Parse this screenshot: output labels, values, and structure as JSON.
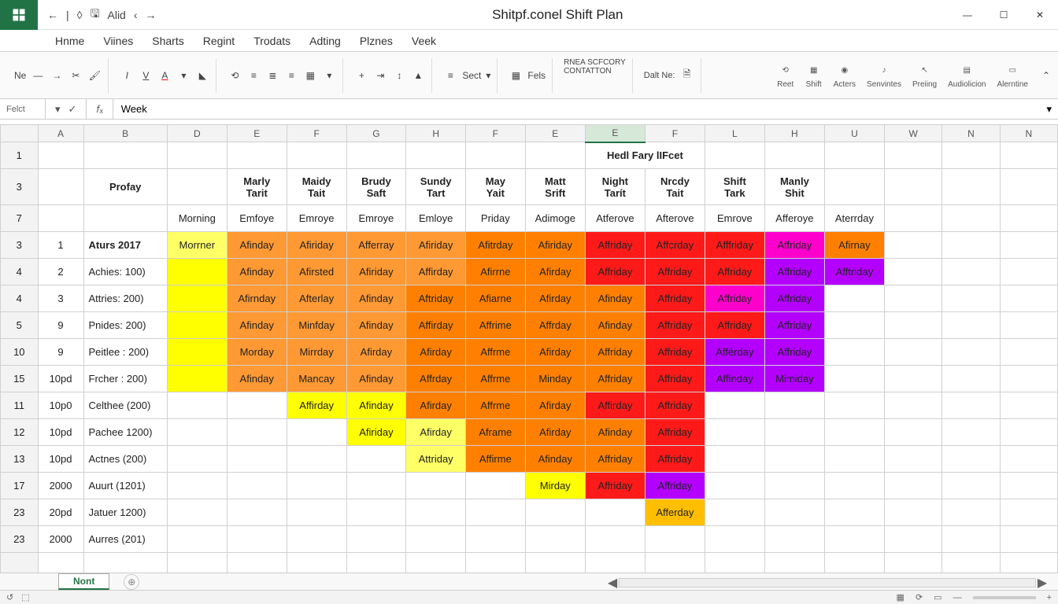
{
  "titlebar": {
    "qat_text": "Alid",
    "title": "Shitpf.conel Shift Plan"
  },
  "tabs": [
    "Hnme",
    "Viines",
    "Sharts",
    "Regint",
    "Trodats",
    "Adting",
    "Plznes",
    "Veek"
  ],
  "ribbon": {
    "left_label": "Ne",
    "sect": "Sect",
    "fels": "Fels",
    "box1a": "RNEA SCFCORY",
    "box1b": "CONTATTON",
    "box2": "Dalt Ne:",
    "icons": [
      "Reet",
      "Shift",
      "Acters",
      "Senvintes",
      "Preiing",
      "Audiolicion",
      "Alerntine"
    ]
  },
  "formula": {
    "namebox": "Felct",
    "value": "Week"
  },
  "columns": [
    "",
    "A",
    "B",
    "D",
    "E",
    "F",
    "G",
    "H",
    "F",
    "E",
    "E",
    "F",
    "L",
    "H",
    "U",
    "W",
    "N",
    "N"
  ],
  "selected_col": 10,
  "row_numbers": [
    "1",
    "3",
    "7",
    "3",
    "4",
    "4",
    "5",
    "10",
    "15",
    "11",
    "12",
    "13",
    "17",
    "23",
    "23"
  ],
  "title_row": "Hedl Fary lIFcet",
  "header_row2": [
    "Profay",
    "",
    "Marly Tarit",
    "Maidy Tait",
    "Brudy Saft",
    "Sundy Tart",
    "May Yait",
    "Matt Srift",
    "Night Tarít",
    "Nrcdy Tait",
    "Shift Tark",
    "Manly Shit",
    "",
    "",
    ""
  ],
  "header_row3": [
    "",
    "Morning",
    "Emfoye",
    "Emroye",
    "Emroye",
    "Emloye",
    "Priday",
    "Adimoge",
    "Atferove",
    "Afterove",
    "Emrove",
    "Afferoye",
    "Aterrday"
  ],
  "rows": [
    {
      "a": "1",
      "b": "Aturs 2017",
      "d": "Morrner",
      "cells": [
        {
          "t": "Afinday",
          "c": "c-ora"
        },
        {
          "t": "Afiriday",
          "c": "c-ora"
        },
        {
          "t": "Afferray",
          "c": "c-ora"
        },
        {
          "t": "Afiriday",
          "c": "c-ora"
        },
        {
          "t": "Afitrday",
          "c": "c-ora2"
        },
        {
          "t": "Afiriday",
          "c": "c-ora2"
        },
        {
          "t": "Affriday",
          "c": "c-red"
        },
        {
          "t": "Affcrday",
          "c": "c-red"
        },
        {
          "t": "Afffriday",
          "c": "c-red"
        },
        {
          "t": "Affriday",
          "c": "c-mag"
        },
        {
          "t": "Afirnay",
          "c": "c-ora2"
        }
      ]
    },
    {
      "a": "2",
      "b": "Achies: 100)",
      "d": "",
      "cells": [
        {
          "t": "Afinday",
          "c": "c-ora"
        },
        {
          "t": "Afirsted",
          "c": "c-ora"
        },
        {
          "t": "Afiriday",
          "c": "c-ora"
        },
        {
          "t": "Affirday",
          "c": "c-ora"
        },
        {
          "t": "Afirrne",
          "c": "c-ora2"
        },
        {
          "t": "Afirday",
          "c": "c-ora2"
        },
        {
          "t": "Affriday",
          "c": "c-red"
        },
        {
          "t": "Affriday",
          "c": "c-red"
        },
        {
          "t": "Affriday",
          "c": "c-red"
        },
        {
          "t": "Affriday",
          "c": "c-pur"
        },
        {
          "t": "Afftriday",
          "c": "c-pur"
        }
      ]
    },
    {
      "a": "3",
      "b": "Attries: 200)",
      "d": "",
      "cells": [
        {
          "t": "Afirnday",
          "c": "c-ora"
        },
        {
          "t": "Afterlay",
          "c": "c-ora"
        },
        {
          "t": "Afinday",
          "c": "c-ora"
        },
        {
          "t": "Aftriday",
          "c": "c-ora2"
        },
        {
          "t": "Afiarne",
          "c": "c-ora2"
        },
        {
          "t": "Afirday",
          "c": "c-ora2"
        },
        {
          "t": "Afinday",
          "c": "c-ora2"
        },
        {
          "t": "Affriday",
          "c": "c-red"
        },
        {
          "t": "Affriday",
          "c": "c-mag"
        },
        {
          "t": "Affriday",
          "c": "c-pur"
        },
        {
          "t": "",
          "c": ""
        }
      ]
    },
    {
      "a": "9",
      "b": "Pnides: 200)",
      "d": "",
      "cells": [
        {
          "t": "Afinday",
          "c": "c-ora"
        },
        {
          "t": "Minfday",
          "c": "c-ora"
        },
        {
          "t": "Afinday",
          "c": "c-ora"
        },
        {
          "t": "Affirday",
          "c": "c-ora2"
        },
        {
          "t": "Affrime",
          "c": "c-ora2"
        },
        {
          "t": "Affrday",
          "c": "c-ora2"
        },
        {
          "t": "Afinday",
          "c": "c-ora2"
        },
        {
          "t": "Affriday",
          "c": "c-red"
        },
        {
          "t": "Affriday",
          "c": "c-red"
        },
        {
          "t": "Affriday",
          "c": "c-pur"
        },
        {
          "t": "",
          "c": ""
        }
      ]
    },
    {
      "a": "9",
      "b": "Peitlee : 200)",
      "d": "",
      "cells": [
        {
          "t": "Morday",
          "c": "c-ora"
        },
        {
          "t": "Mirrday",
          "c": "c-ora"
        },
        {
          "t": "Afirday",
          "c": "c-ora"
        },
        {
          "t": "Afirday",
          "c": "c-ora2"
        },
        {
          "t": "Affrme",
          "c": "c-ora2"
        },
        {
          "t": "Afirday",
          "c": "c-ora2"
        },
        {
          "t": "Affriday",
          "c": "c-ora2"
        },
        {
          "t": "Affriday",
          "c": "c-red"
        },
        {
          "t": "Afférday",
          "c": "c-pur"
        },
        {
          "t": "Affriday",
          "c": "c-pur"
        },
        {
          "t": "",
          "c": ""
        }
      ]
    },
    {
      "a": "10pd",
      "b": "Frcher : 200)",
      "d": "",
      "cells": [
        {
          "t": "Afinday",
          "c": "c-ora"
        },
        {
          "t": "Mancay",
          "c": "c-ora"
        },
        {
          "t": "Afinday",
          "c": "c-ora"
        },
        {
          "t": "Affrday",
          "c": "c-ora2"
        },
        {
          "t": "Affrme",
          "c": "c-ora2"
        },
        {
          "t": "Minday",
          "c": "c-ora2"
        },
        {
          "t": "Affriday",
          "c": "c-ora2"
        },
        {
          "t": "Affriday",
          "c": "c-red"
        },
        {
          "t": "Affinday",
          "c": "c-pur"
        },
        {
          "t": "Mimiday",
          "c": "c-pur"
        },
        {
          "t": "",
          "c": ""
        }
      ]
    },
    {
      "a": "10p0",
      "b": "Celthee (200)",
      "d": "",
      "cells": [
        {
          "t": "",
          "c": ""
        },
        {
          "t": "Affirday",
          "c": "c-yel"
        },
        {
          "t": "Afinday",
          "c": "c-yel"
        },
        {
          "t": "Afirday",
          "c": "c-ora2"
        },
        {
          "t": "Affrme",
          "c": "c-ora2"
        },
        {
          "t": "Afirday",
          "c": "c-ora2"
        },
        {
          "t": "Affirday",
          "c": "c-red"
        },
        {
          "t": "Affriday",
          "c": "c-red"
        },
        {
          "t": "",
          "c": ""
        },
        {
          "t": "",
          "c": ""
        },
        {
          "t": "",
          "c": ""
        }
      ]
    },
    {
      "a": "10pd",
      "b": "Pachee 1200)",
      "d": "",
      "cells": [
        {
          "t": "",
          "c": ""
        },
        {
          "t": "",
          "c": ""
        },
        {
          "t": "Afiriday",
          "c": "c-yel"
        },
        {
          "t": "Afirday",
          "c": "c-yel2"
        },
        {
          "t": "Aframe",
          "c": "c-ora2"
        },
        {
          "t": "Afirday",
          "c": "c-ora2"
        },
        {
          "t": "Afinday",
          "c": "c-ora2"
        },
        {
          "t": "Affriday",
          "c": "c-red"
        },
        {
          "t": "",
          "c": ""
        },
        {
          "t": "",
          "c": ""
        },
        {
          "t": "",
          "c": ""
        }
      ]
    },
    {
      "a": "10pd",
      "b": "Actnes (200)",
      "d": "",
      "cells": [
        {
          "t": "",
          "c": ""
        },
        {
          "t": "",
          "c": ""
        },
        {
          "t": "",
          "c": ""
        },
        {
          "t": "Attriday",
          "c": "c-yel2"
        },
        {
          "t": "Affirme",
          "c": "c-ora2"
        },
        {
          "t": "Afinday",
          "c": "c-ora2"
        },
        {
          "t": "Affriday",
          "c": "c-ora2"
        },
        {
          "t": "Affriday",
          "c": "c-red"
        },
        {
          "t": "",
          "c": ""
        },
        {
          "t": "",
          "c": ""
        },
        {
          "t": "",
          "c": ""
        }
      ]
    },
    {
      "a": "2000",
      "b": "Auurt (1201)",
      "d": "",
      "cells": [
        {
          "t": "",
          "c": ""
        },
        {
          "t": "",
          "c": ""
        },
        {
          "t": "",
          "c": ""
        },
        {
          "t": "",
          "c": ""
        },
        {
          "t": "",
          "c": ""
        },
        {
          "t": "Mirday",
          "c": "c-yel"
        },
        {
          "t": "Affriday",
          "c": "c-red"
        },
        {
          "t": "Affriday",
          "c": "c-pur"
        },
        {
          "t": "",
          "c": ""
        },
        {
          "t": "",
          "c": ""
        },
        {
          "t": "",
          "c": ""
        }
      ]
    },
    {
      "a": "20pd",
      "b": "Jatuer 1200)",
      "d": "",
      "cells": [
        {
          "t": "",
          "c": ""
        },
        {
          "t": "",
          "c": ""
        },
        {
          "t": "",
          "c": ""
        },
        {
          "t": "",
          "c": ""
        },
        {
          "t": "",
          "c": ""
        },
        {
          "t": "",
          "c": ""
        },
        {
          "t": "",
          "c": ""
        },
        {
          "t": "Afferday",
          "c": "c-amb"
        },
        {
          "t": "",
          "c": ""
        },
        {
          "t": "",
          "c": ""
        },
        {
          "t": "",
          "c": ""
        }
      ]
    },
    {
      "a": "2000",
      "b": "Aurres (201)",
      "d": "",
      "cells": [
        {
          "t": "",
          "c": ""
        },
        {
          "t": "",
          "c": ""
        },
        {
          "t": "",
          "c": ""
        },
        {
          "t": "",
          "c": ""
        },
        {
          "t": "",
          "c": ""
        },
        {
          "t": "",
          "c": ""
        },
        {
          "t": "",
          "c": ""
        },
        {
          "t": "",
          "c": ""
        },
        {
          "t": "",
          "c": ""
        },
        {
          "t": "",
          "c": ""
        },
        {
          "t": "",
          "c": ""
        }
      ]
    }
  ],
  "sheet": "Nont"
}
